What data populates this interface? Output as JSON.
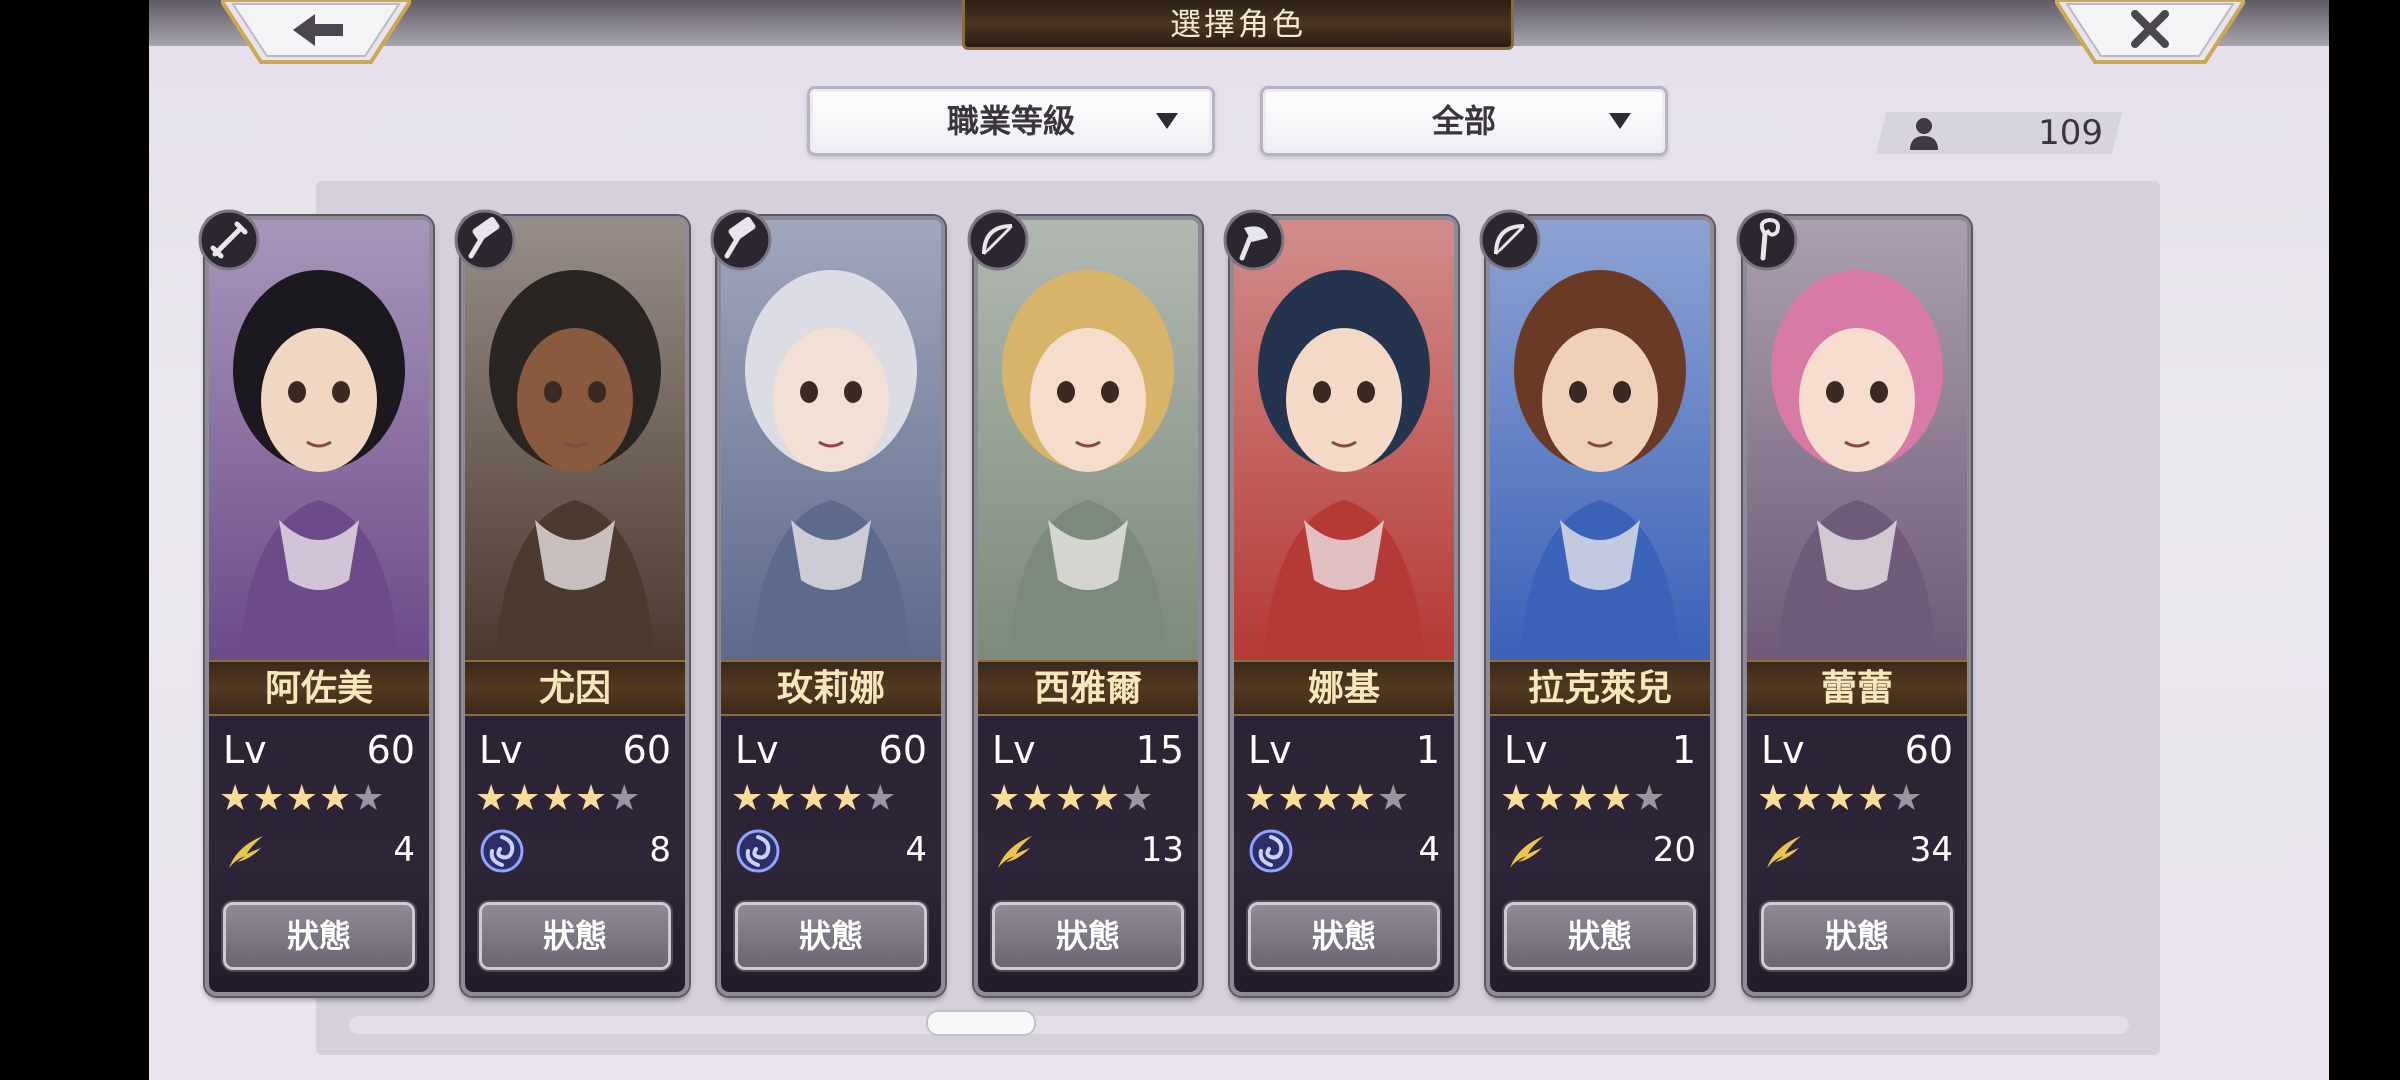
{
  "header": {
    "title": "選擇角色",
    "back_icon": "back-arrow-icon",
    "close_icon": "close-x-icon"
  },
  "filters": {
    "job_dropdown": {
      "label": "職業等級"
    },
    "category_dropdown": {
      "label": "全部"
    }
  },
  "roster_count": {
    "icon": "person-icon",
    "value": "109"
  },
  "characters": [
    {
      "name": "阿佐美",
      "lv_label": "Lv",
      "level": "60",
      "stars": 4,
      "element": "wind",
      "element_count": "4",
      "status_label": "狀態",
      "job_icon": "sword-icon"
    },
    {
      "name": "尤因",
      "lv_label": "Lv",
      "level": "60",
      "stars": 4,
      "element": "water",
      "element_count": "8",
      "status_label": "狀態",
      "job_icon": "hammer-icon"
    },
    {
      "name": "玫莉娜",
      "lv_label": "Lv",
      "level": "60",
      "stars": 4,
      "element": "water",
      "element_count": "4",
      "status_label": "狀態",
      "job_icon": "hammer-icon"
    },
    {
      "name": "西雅爾",
      "lv_label": "Lv",
      "level": "15",
      "stars": 4,
      "element": "wind",
      "element_count": "13",
      "status_label": "狀態",
      "job_icon": "bow-icon"
    },
    {
      "name": "娜基",
      "lv_label": "Lv",
      "level": "1",
      "stars": 4,
      "element": "water",
      "element_count": "4",
      "status_label": "狀態",
      "job_icon": "axe-icon"
    },
    {
      "name": "拉克萊兒",
      "lv_label": "Lv",
      "level": "1",
      "stars": 4,
      "element": "wind",
      "element_count": "20",
      "status_label": "狀態",
      "job_icon": "bow-icon"
    },
    {
      "name": "蕾蕾",
      "lv_label": "Lv",
      "level": "60",
      "stars": 4,
      "element": "wind",
      "element_count": "34",
      "status_label": "狀態",
      "job_icon": "staff-icon"
    }
  ],
  "colors": {
    "wind": "#e8c64a",
    "water": "#8fa3ff",
    "gold_text": "#f7e7bd",
    "card_bgs": [
      "#6b4b8a",
      "#4c3a2f",
      "#5d6a8c",
      "#7b8a7a",
      "#b53a35",
      "#3a62b8",
      "#6f5b77"
    ]
  }
}
